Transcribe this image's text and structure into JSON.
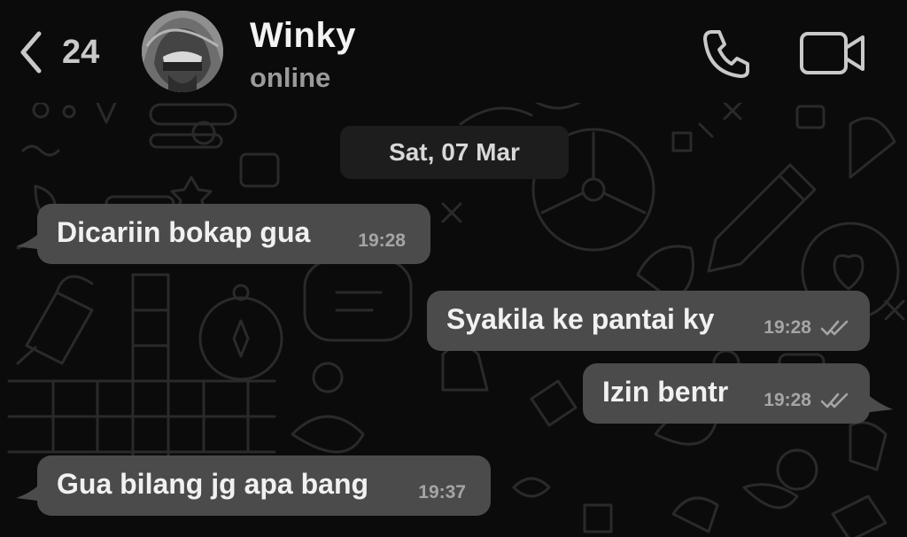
{
  "header": {
    "back_count": "24",
    "contact_name": "Winky",
    "contact_status": "online",
    "icons": [
      "back-chevron-icon",
      "phone-icon",
      "video-camera-icon"
    ]
  },
  "date_separator": "Sat, 07 Mar",
  "messages": [
    {
      "text": "Dicariin bokap gua",
      "time": "19:28",
      "direction": "incoming"
    },
    {
      "text": "Syakila ke pantai ky",
      "time": "19:28",
      "direction": "outgoing",
      "status": "read"
    },
    {
      "text": "Izin bentr",
      "time": "19:28",
      "direction": "outgoing",
      "status": "read"
    },
    {
      "text": "Gua bilang jg apa bang",
      "time": "19:37",
      "direction": "incoming"
    }
  ],
  "colors": {
    "background": "#0b0b0b",
    "bubble": "#4b4b4b",
    "date_chip": "#1d1d1d",
    "wallpaper_doodle": "#2a2a2a",
    "text_primary": "#f1f1f1",
    "text_secondary": "#9b9b9b"
  }
}
